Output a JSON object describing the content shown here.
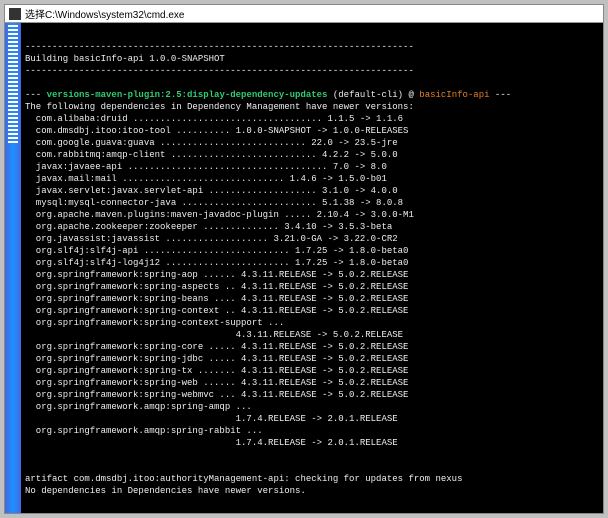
{
  "window": {
    "title": "选择C:\\Windows\\system32\\cmd.exe"
  },
  "hr": "------------------------------------------------------------------------",
  "building": "Building basicInfo-api 1.0.0-SNAPSHOT",
  "goal": {
    "dashes": "--- ",
    "plugin": "versions-maven-plugin:2.5:display-dependency-updates",
    "mid": " (default-cli) @ ",
    "artifact": "basicInfo-api",
    "end": " ---"
  },
  "header": "The following dependencies in Dependency Management have newer versions:",
  "rows": [
    "  com.alibaba:druid ................................... 1.1.5 -> 1.1.6",
    "  com.dmsdbj.itoo:itoo-tool .......... 1.0.0-SNAPSHOT -> 1.0.0-RELEASES",
    "  com.google.guava:guava ........................... 22.0 -> 23.5-jre",
    "  com.rabbitmq:amqp-client ........................... 4.2.2 -> 5.0.0",
    "  javax:javaee-api ..................................... 7.0 -> 8.0",
    "  javax.mail:mail .............................. 1.4.6 -> 1.5.0-b01",
    "  javax.servlet:javax.servlet-api .................... 3.1.0 -> 4.0.0",
    "  mysql:mysql-connector-java ......................... 5.1.38 -> 8.0.8",
    "  org.apache.maven.plugins:maven-javadoc-plugin ..... 2.10.4 -> 3.0.0-M1",
    "  org.apache.zookeeper:zookeeper .............. 3.4.10 -> 3.5.3-beta",
    "  org.javassist:javassist ................... 3.21.0-GA -> 3.22.0-CR2",
    "  org.slf4j:slf4j-api ........................... 1.7.25 -> 1.8.0-beta0",
    "  org.slf4j:slf4j-log4j12 ....................... 1.7.25 -> 1.8.0-beta0",
    "  org.springframework:spring-aop ...... 4.3.11.RELEASE -> 5.0.2.RELEASE",
    "  org.springframework:spring-aspects .. 4.3.11.RELEASE -> 5.0.2.RELEASE",
    "  org.springframework:spring-beans .... 4.3.11.RELEASE -> 5.0.2.RELEASE",
    "  org.springframework:spring-context .. 4.3.11.RELEASE -> 5.0.2.RELEASE",
    "  org.springframework:spring-context-support ...",
    "                                       4.3.11.RELEASE -> 5.0.2.RELEASE",
    "  org.springframework:spring-core ..... 4.3.11.RELEASE -> 5.0.2.RELEASE",
    "  org.springframework:spring-jdbc ..... 4.3.11.RELEASE -> 5.0.2.RELEASE",
    "  org.springframework:spring-tx ....... 4.3.11.RELEASE -> 5.0.2.RELEASE",
    "  org.springframework:spring-web ...... 4.3.11.RELEASE -> 5.0.2.RELEASE",
    "  org.springframework:spring-webmvc ... 4.3.11.RELEASE -> 5.0.2.RELEASE",
    "  org.springframework.amqp:spring-amqp ...",
    "                                       1.7.4.RELEASE -> 2.0.1.RELEASE",
    "  org.springframework.amqp:spring-rabbit ...",
    "                                       1.7.4.RELEASE -> 2.0.1.RELEASE"
  ],
  "footer1": "artifact com.dmsdbj.itoo:authorityManagement-api: checking for updates from nexus",
  "footer2": "No dependencies in Dependencies have newer versions."
}
